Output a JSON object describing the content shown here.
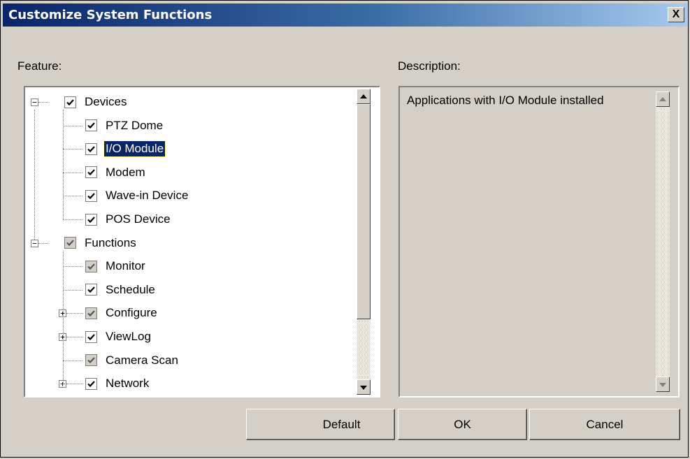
{
  "window": {
    "title": "Customize System Functions",
    "close_label": "X"
  },
  "labels": {
    "feature": "Feature:",
    "description": "Description:"
  },
  "tree": {
    "items": [
      {
        "label": "Devices",
        "level": 0,
        "expander": "−",
        "checked": true
      },
      {
        "label": "PTZ Dome",
        "level": 1,
        "checked": true
      },
      {
        "label": "I/O Module",
        "level": 1,
        "checked": true,
        "selected": true
      },
      {
        "label": "Modem",
        "level": 1,
        "checked": true
      },
      {
        "label": "Wave-in Device",
        "level": 1,
        "checked": true
      },
      {
        "label": "POS Device",
        "level": 1,
        "checked": true
      },
      {
        "label": "Functions",
        "level": 0,
        "expander": "−",
        "checked": true,
        "grayed": true
      },
      {
        "label": "Monitor",
        "level": 1,
        "checked": true,
        "grayed": true
      },
      {
        "label": "Schedule",
        "level": 1,
        "checked": true
      },
      {
        "label": "Configure",
        "level": 1,
        "expander": "+",
        "checked": true,
        "grayed": true
      },
      {
        "label": "ViewLog",
        "level": 1,
        "expander": "+",
        "checked": true
      },
      {
        "label": "Camera Scan",
        "level": 1,
        "checked": true,
        "grayed": true
      },
      {
        "label": "Network",
        "level": 1,
        "expander": "+",
        "checked": true
      }
    ]
  },
  "description": {
    "text": "Applications with I/O Module installed"
  },
  "buttons": {
    "default": "Default",
    "ok": "OK",
    "cancel": "Cancel"
  },
  "colors": {
    "title_start": "#0a246a",
    "title_end": "#a6caf0",
    "selection": "#0a246a",
    "face": "#d4d0c8"
  }
}
